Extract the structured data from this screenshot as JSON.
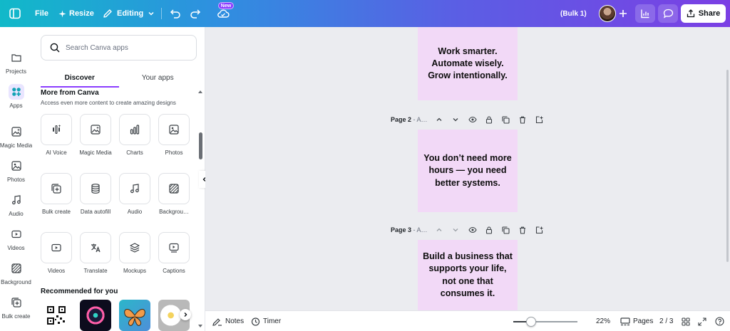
{
  "header": {
    "file_label": "File",
    "resize_label": "Resize",
    "editing_label": "Editing",
    "new_badge": "New",
    "design_name": "(Bulk 1)",
    "share_label": "Share"
  },
  "rail": {
    "items": [
      {
        "label": "Projects",
        "icon": "folder-icon"
      },
      {
        "label": "Apps",
        "icon": "apps-icon"
      },
      {
        "label": "Magic Media",
        "icon": "magic-media-icon"
      },
      {
        "label": "Photos",
        "icon": "photo-icon"
      },
      {
        "label": "Audio",
        "icon": "music-icon"
      },
      {
        "label": "Videos",
        "icon": "video-icon"
      },
      {
        "label": "Background",
        "icon": "background-icon"
      },
      {
        "label": "Bulk create",
        "icon": "bulk-create-icon"
      }
    ]
  },
  "panel": {
    "search_placeholder": "Search Canva apps",
    "tabs": [
      {
        "label": "Discover",
        "active": true
      },
      {
        "label": "Your apps",
        "active": false
      }
    ],
    "section_title": "More from Canva",
    "section_subtitle": "Access even more content to create amazing designs",
    "apps": [
      {
        "label": "AI Voice",
        "icon": "ai-voice-icon"
      },
      {
        "label": "Magic Media",
        "icon": "magic-media-icon"
      },
      {
        "label": "Charts",
        "icon": "charts-icon"
      },
      {
        "label": "Photos",
        "icon": "photo-icon"
      },
      {
        "label": "Bulk create",
        "icon": "bulk-create-icon"
      },
      {
        "label": "Data autofill",
        "icon": "database-icon"
      },
      {
        "label": "Audio",
        "icon": "music-icon"
      },
      {
        "label": "Backgrou…",
        "icon": "background-icon"
      },
      {
        "label": "Videos",
        "icon": "video-icon"
      },
      {
        "label": "Translate",
        "icon": "translate-icon"
      },
      {
        "label": "Mockups",
        "icon": "mockups-icon"
      },
      {
        "label": "Captions",
        "icon": "captions-icon"
      }
    ],
    "recommended_title": "Recommended for you"
  },
  "canvas": {
    "pages": [
      {
        "label": "",
        "text": "Work smarter. Automate wisely. Grow intentionally."
      },
      {
        "label": "Page 2",
        "suffix": " - A…",
        "text": "You don’t need more hours — you need better systems."
      },
      {
        "label": "Page 3",
        "suffix": " - A…",
        "text": "Build a business that supports your life, not one that consumes it."
      }
    ]
  },
  "footer": {
    "notes_label": "Notes",
    "timer_label": "Timer",
    "zoom": "22%",
    "pages_label": "Pages",
    "page_count": "2 / 3",
    "zoom_fraction": 0.22
  },
  "colors": {
    "accent": "#8b3dff",
    "page_fill": "#f2d9f7",
    "header_gradient_start": "#11b9c9",
    "header_gradient_end": "#7b3fe4"
  }
}
